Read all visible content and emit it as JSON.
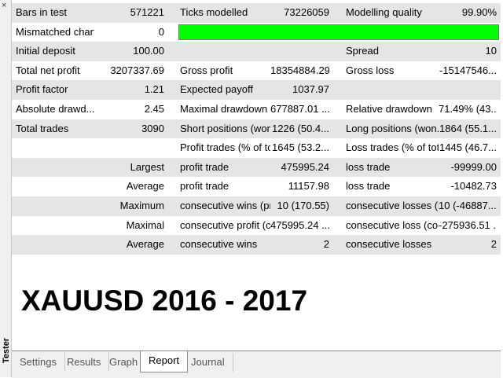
{
  "side": {
    "title": "Tester",
    "close": "×"
  },
  "report": {
    "rows": [
      [
        "Bars in test",
        "571221",
        "Ticks modelled",
        "73226059",
        "Modelling quality",
        "99.90%"
      ],
      [
        "Mismatched chart...",
        "0",
        "",
        "",
        "",
        ""
      ],
      [
        "Initial deposit",
        "100.00",
        "",
        "",
        "Spread",
        "10"
      ],
      [
        "Total net profit",
        "3207337.69",
        "Gross profit",
        "18354884.29",
        "Gross loss",
        "-15147546..."
      ],
      [
        "Profit factor",
        "1.21",
        "Expected payoff",
        "1037.97",
        "",
        ""
      ],
      [
        "Absolute drawd...",
        "2.45",
        "Maximal drawdown",
        "677887.01 ...",
        "Relative drawdown",
        "71.49% (43..."
      ],
      [
        "Total trades",
        "3090",
        "Short positions (won...",
        "1226 (50.4...",
        "Long positions (won...",
        "1864 (55.1..."
      ],
      [
        "",
        "",
        "Profit trades (% of to...",
        "1645 (53.2...",
        "Loss trades (% of total)",
        "1445 (46.7..."
      ],
      [
        "",
        "Largest",
        "profit trade",
        "475995.24",
        "loss trade",
        "-99999.00"
      ],
      [
        "",
        "Average",
        "profit trade",
        "11157.98",
        "loss trade",
        "-10482.73"
      ],
      [
        "",
        "Maximum",
        "consecutive wins (pro...",
        "10 (170.55)",
        "consecutive losses (lo...",
        "10 (-46887...."
      ],
      [
        "",
        "Maximal",
        "consecutive profit (co...",
        "475995.24 ...",
        "consecutive loss (cou...",
        "-275936.51 ..."
      ],
      [
        "",
        "Average",
        "consecutive wins",
        "2",
        "consecutive losses",
        "2"
      ]
    ],
    "modelling_quality_bar": {
      "color": "#00ff00",
      "fill": 1.0
    }
  },
  "caption": "XAUUSD 2016 - 2017",
  "tabs": [
    {
      "label": "Settings",
      "active": false
    },
    {
      "label": "Results",
      "active": false
    },
    {
      "label": "Graph",
      "active": false
    },
    {
      "label": "Report",
      "active": true
    },
    {
      "label": "Journal",
      "active": false
    }
  ]
}
